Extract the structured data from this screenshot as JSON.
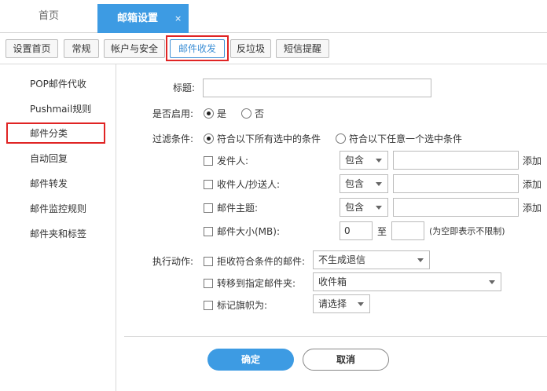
{
  "tabs": {
    "home": "首页",
    "active": "邮箱设置",
    "close": "×"
  },
  "toolbar": {
    "buttons": [
      "设置首页",
      "常规",
      "帐户与安全",
      "邮件收发",
      "反垃圾",
      "短信提醒"
    ],
    "current": "邮件收发"
  },
  "sidebar": {
    "items": [
      "POP邮件代收",
      "Pushmail规则",
      "邮件分类",
      "自动回复",
      "邮件转发",
      "邮件监控规则",
      "邮件夹和标签"
    ],
    "current": "邮件分类"
  },
  "form": {
    "title_label": "标题:",
    "title_value": "",
    "enable_label": "是否启用:",
    "enable_yes": "是",
    "enable_no": "否",
    "enable_selected": "是",
    "filter_label": "过滤条件:",
    "filter_all": "符合以下所有选中的条件",
    "filter_any": "符合以下任意一个选中条件",
    "filter_selected": "all",
    "conditions": [
      {
        "label": "发件人:",
        "op": "包含",
        "value": "",
        "add": "添加"
      },
      {
        "label": "收件人/抄送人:",
        "op": "包含",
        "value": "",
        "add": "添加"
      },
      {
        "label": "邮件主题:",
        "op": "包含",
        "value": "",
        "add": "添加"
      }
    ],
    "size_label": "邮件大小(MB):",
    "size_from": "0",
    "size_to_label": "至",
    "size_to": "",
    "size_hint": "(为空即表示不限制)",
    "action_label": "执行动作:",
    "actions": [
      {
        "label": "拒收符合条件的邮件:",
        "value": "不生成退信"
      },
      {
        "label": "转移到指定邮件夹:",
        "value": "收件箱"
      },
      {
        "label": "标记旗帜为:",
        "value": "请选择"
      }
    ],
    "ok": "确定",
    "cancel": "取消"
  },
  "colors": {
    "accent": "#3d9be3",
    "highlight": "#e02424"
  }
}
